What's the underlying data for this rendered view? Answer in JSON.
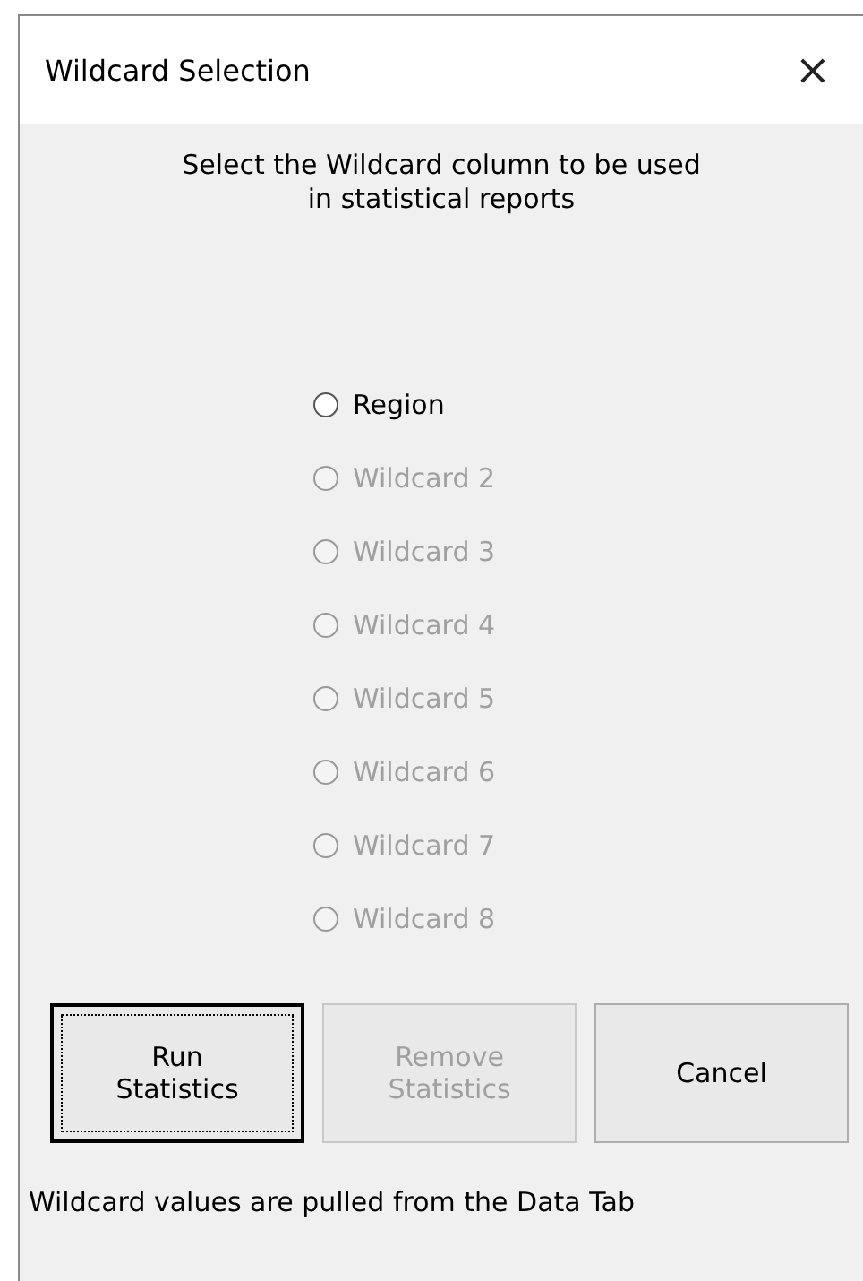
{
  "window": {
    "title": "Wildcard Selection",
    "close": "×"
  },
  "instruction": "Select the Wildcard column to be used in statistical reports",
  "options": [
    {
      "label": "Region",
      "selected": false,
      "disabled": false
    },
    {
      "label": "Wildcard 2",
      "selected": false,
      "disabled": true
    },
    {
      "label": "Wildcard 3",
      "selected": false,
      "disabled": true
    },
    {
      "label": "Wildcard 4",
      "selected": false,
      "disabled": true
    },
    {
      "label": "Wildcard 5",
      "selected": false,
      "disabled": true
    },
    {
      "label": "Wildcard 6",
      "selected": false,
      "disabled": true
    },
    {
      "label": "Wildcard 7",
      "selected": false,
      "disabled": true
    },
    {
      "label": "Wildcard 8",
      "selected": false,
      "disabled": true
    }
  ],
  "buttons": [
    {
      "label": "Run Statistics",
      "focused": true,
      "disabled": false
    },
    {
      "label": "Remove Statistics",
      "focused": false,
      "disabled": true
    },
    {
      "label": "Cancel",
      "focused": false,
      "disabled": false
    }
  ],
  "footer": "Wildcard values are pulled from the Data Tab"
}
